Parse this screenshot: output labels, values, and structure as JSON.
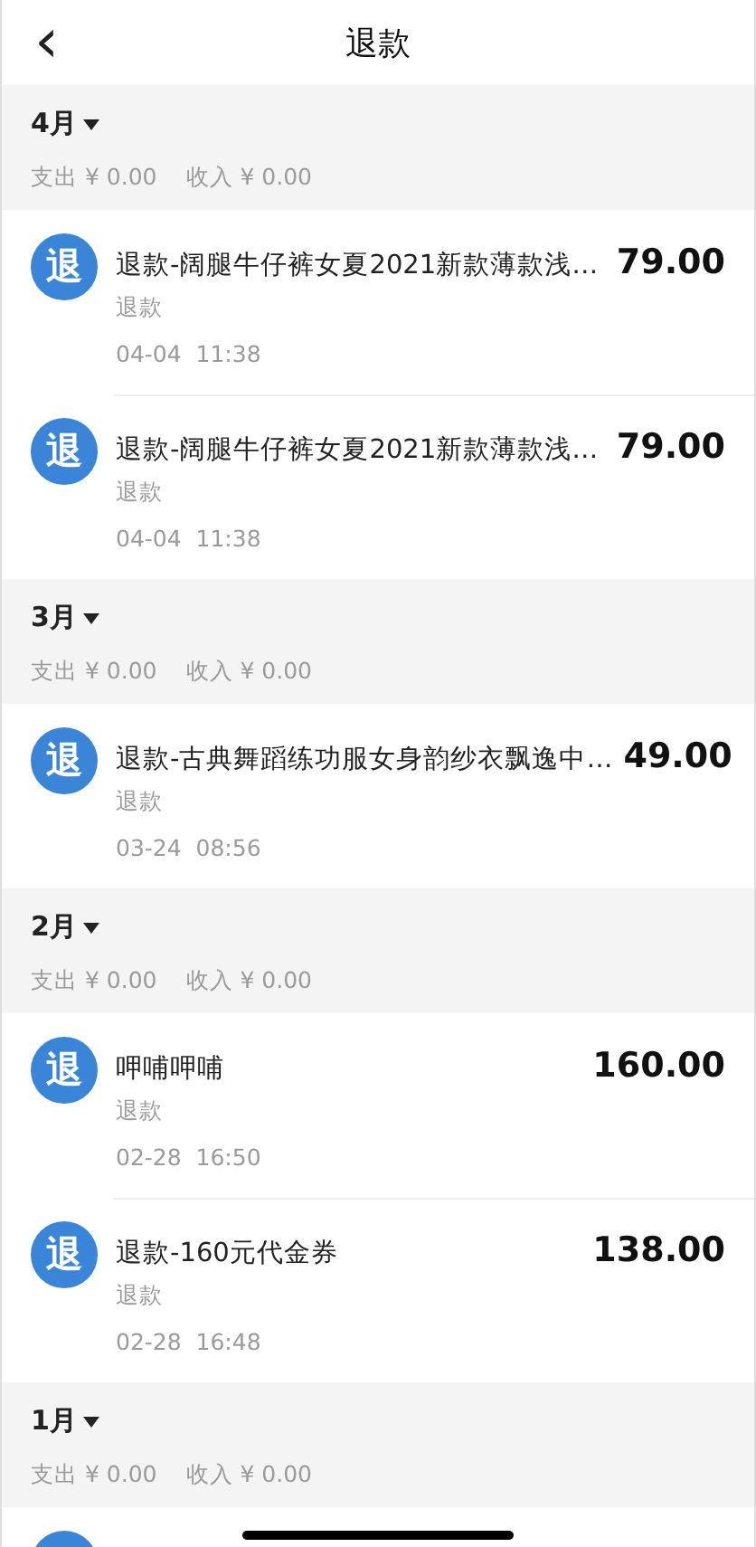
{
  "header": {
    "back": "‹",
    "title": "退款"
  },
  "months": [
    {
      "label": "4月",
      "expanded": true,
      "summary": [
        {
          "label": "支出",
          "amount": "¥ 0.00"
        },
        {
          "label": "收入",
          "amount": "¥ 0.00"
        }
      ],
      "items": [
        {
          "icon": "退",
          "title": "退款-阔腿牛仔裤女夏2021新款薄款浅…",
          "type": "退款",
          "time": "04-04  11:38",
          "amount": "79.00"
        },
        {
          "icon": "退",
          "title": "退款-阔腿牛仔裤女夏2021新款薄款浅…",
          "type": "退款",
          "time": "04-04  11:38",
          "amount": "79.00"
        }
      ]
    },
    {
      "label": "3月",
      "expanded": true,
      "summary": [
        {
          "label": "支出",
          "amount": "¥ 0.00"
        },
        {
          "label": "收入",
          "amount": "¥ 0.00"
        }
      ],
      "items": [
        {
          "icon": "退",
          "title": "退款-古典舞蹈练功服女身韵纱衣飘逸中…",
          "type": "退款",
          "time": "03-24  08:56",
          "amount": "49.00"
        }
      ]
    },
    {
      "label": "2月",
      "expanded": true,
      "summary": [
        {
          "label": "支出",
          "amount": "¥ 0.00"
        },
        {
          "label": "收入",
          "amount": "¥ 0.00"
        }
      ],
      "items": [
        {
          "icon": "退",
          "title": "呷哺呷哺",
          "type": "退款",
          "time": "02-28  16:50",
          "amount": "160.00"
        },
        {
          "icon": "退",
          "title": "退款-160元代金券",
          "type": "退款",
          "time": "02-28  16:48",
          "amount": "138.00"
        }
      ]
    },
    {
      "label": "1月",
      "expanded": true,
      "summary": [
        {
          "label": "支出",
          "amount": "¥ 0.00"
        },
        {
          "label": "收入",
          "amount": "¥ 0.00"
        }
      ],
      "partial_item": true
    }
  ]
}
